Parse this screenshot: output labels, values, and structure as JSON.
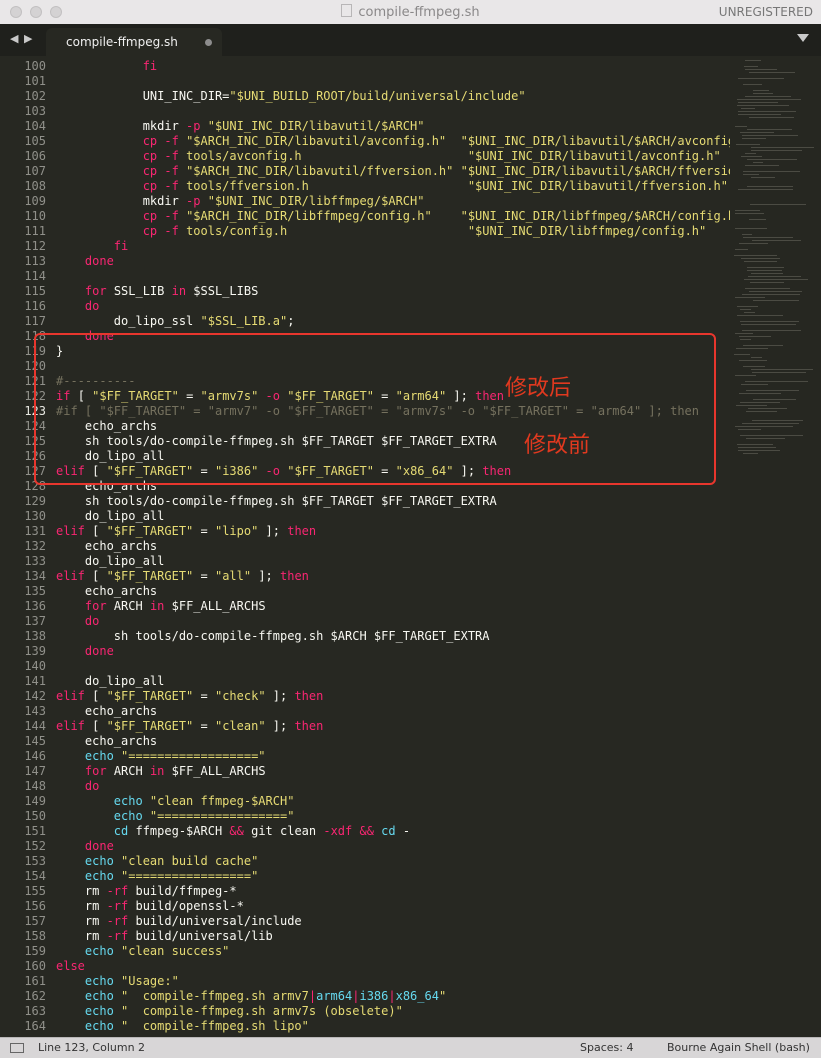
{
  "window": {
    "title": "compile-ffmpeg.sh",
    "registration": "UNREGISTERED"
  },
  "tab": {
    "label": "compile-ffmpeg.sh"
  },
  "status": {
    "position": "Line 123, Column 2",
    "spaces": "Spaces: 4",
    "syntax": "Bourne Again Shell (bash)"
  },
  "annotations": {
    "after": "修改后",
    "before": "修改前"
  },
  "colors": {
    "editor_bg": "#272822",
    "keyword": "#f92672",
    "string": "#e6db74",
    "annotation": "#e8362d"
  },
  "lines": [
    {
      "n": "100",
      "t": [
        [
          "            ",
          ""
        ],
        [
          "fi",
          "kw"
        ]
      ]
    },
    {
      "n": "101",
      "t": []
    },
    {
      "n": "102",
      "t": [
        [
          "            UNI_INC_DIR=",
          ""
        ],
        [
          "\"$UNI_BUILD_ROOT/build/universal/include\"",
          "str"
        ]
      ]
    },
    {
      "n": "103",
      "t": []
    },
    {
      "n": "104",
      "t": [
        [
          "            mkdir ",
          ""
        ],
        [
          "-p ",
          "kw"
        ],
        [
          "\"$UNI_INC_DIR/libavutil/$ARCH\"",
          "str"
        ]
      ]
    },
    {
      "n": "105",
      "t": [
        [
          "            cp ",
          "kw"
        ],
        [
          "-f ",
          "kw"
        ],
        [
          "\"$ARCH_INC_DIR/libavutil/avconfig.h\"  ",
          "str"
        ],
        [
          "\"$UNI_INC_DIR/libavutil/$ARCH/avconfig.h\"",
          "str"
        ]
      ]
    },
    {
      "n": "106",
      "t": [
        [
          "            cp ",
          "kw"
        ],
        [
          "-f ",
          "kw"
        ],
        [
          "tools/avconfig.h                       ",
          "str"
        ],
        [
          "\"$UNI_INC_DIR/libavutil/avconfig.h\"",
          "str"
        ]
      ]
    },
    {
      "n": "107",
      "t": [
        [
          "            cp ",
          "kw"
        ],
        [
          "-f ",
          "kw"
        ],
        [
          "\"$ARCH_INC_DIR/libavutil/ffversion.h\" ",
          "str"
        ],
        [
          "\"$UNI_INC_DIR/libavutil/$ARCH/ffversion.h\"",
          "str"
        ]
      ]
    },
    {
      "n": "108",
      "t": [
        [
          "            cp ",
          "kw"
        ],
        [
          "-f ",
          "kw"
        ],
        [
          "tools/ffversion.h                      ",
          "str"
        ],
        [
          "\"$UNI_INC_DIR/libavutil/ffversion.h\"",
          "str"
        ]
      ]
    },
    {
      "n": "109",
      "t": [
        [
          "            mkdir ",
          ""
        ],
        [
          "-p ",
          "kw"
        ],
        [
          "\"$UNI_INC_DIR/libffmpeg/$ARCH\"",
          "str"
        ]
      ]
    },
    {
      "n": "110",
      "t": [
        [
          "            cp ",
          "kw"
        ],
        [
          "-f ",
          "kw"
        ],
        [
          "\"$ARCH_INC_DIR/libffmpeg/config.h\"    ",
          "str"
        ],
        [
          "\"$UNI_INC_DIR/libffmpeg/$ARCH/config.h\"",
          "str"
        ]
      ]
    },
    {
      "n": "111",
      "t": [
        [
          "            cp ",
          "kw"
        ],
        [
          "-f ",
          "kw"
        ],
        [
          "tools/config.h                         ",
          "str"
        ],
        [
          "\"$UNI_INC_DIR/libffmpeg/config.h\"",
          "str"
        ]
      ]
    },
    {
      "n": "112",
      "t": [
        [
          "        ",
          ""
        ],
        [
          "fi",
          "kw"
        ]
      ]
    },
    {
      "n": "113",
      "t": [
        [
          "    ",
          ""
        ],
        [
          "done",
          "kw"
        ]
      ]
    },
    {
      "n": "114",
      "t": []
    },
    {
      "n": "115",
      "t": [
        [
          "    ",
          ""
        ],
        [
          "for ",
          "kw"
        ],
        [
          "SSL_LIB ",
          ""
        ],
        [
          "in ",
          "kw"
        ],
        [
          "$SSL_LIBS",
          ""
        ]
      ]
    },
    {
      "n": "116",
      "t": [
        [
          "    ",
          ""
        ],
        [
          "do",
          "kw"
        ]
      ]
    },
    {
      "n": "117",
      "t": [
        [
          "        do_lipo_ssl ",
          ""
        ],
        [
          "\"$SSL_LIB.a\"",
          "str"
        ],
        [
          ";",
          ""
        ]
      ]
    },
    {
      "n": "118",
      "t": [
        [
          "    ",
          ""
        ],
        [
          "done",
          "kw"
        ]
      ]
    },
    {
      "n": "119",
      "t": [
        [
          "}",
          ""
        ]
      ]
    },
    {
      "n": "120",
      "t": []
    },
    {
      "n": "121",
      "t": [
        [
          "#----------",
          "cmt"
        ]
      ]
    },
    {
      "n": "122",
      "t": [
        [
          "if ",
          "kw"
        ],
        [
          "[ ",
          ""
        ],
        [
          "\"$FF_TARGET\"",
          "str"
        ],
        [
          " = ",
          ""
        ],
        [
          "\"armv7s\"",
          "str"
        ],
        [
          " -o ",
          "kw"
        ],
        [
          "\"$FF_TARGET\"",
          "str"
        ],
        [
          " = ",
          ""
        ],
        [
          "\"arm64\"",
          "str"
        ],
        [
          " ]; ",
          ""
        ],
        [
          "then",
          "kw"
        ]
      ]
    },
    {
      "n": "123",
      "t": [
        [
          "#if [ \"$FF_TARGET\" = \"armv7\" -o \"$FF_TARGET\" = \"armv7s\" -o \"$FF_TARGET\" = \"arm64\" ]; then",
          "cmt"
        ]
      ]
    },
    {
      "n": "124",
      "t": [
        [
          "    echo_archs",
          ""
        ]
      ]
    },
    {
      "n": "125",
      "t": [
        [
          "    sh tools/do-compile-ffmpeg.sh ",
          ""
        ],
        [
          "$FF_TARGET $FF_TARGET_EXTRA",
          ""
        ]
      ]
    },
    {
      "n": "126",
      "t": [
        [
          "    do_lipo_all",
          ""
        ]
      ]
    },
    {
      "n": "127",
      "t": [
        [
          "elif ",
          "kw"
        ],
        [
          "[ ",
          ""
        ],
        [
          "\"$FF_TARGET\"",
          "str"
        ],
        [
          " = ",
          ""
        ],
        [
          "\"i386\"",
          "str"
        ],
        [
          " -o ",
          "kw"
        ],
        [
          "\"$FF_TARGET\"",
          "str"
        ],
        [
          " = ",
          ""
        ],
        [
          "\"x86_64\"",
          "str"
        ],
        [
          " ]; ",
          ""
        ],
        [
          "then",
          "kw"
        ]
      ]
    },
    {
      "n": "128",
      "t": [
        [
          "    echo_archs",
          ""
        ]
      ]
    },
    {
      "n": "129",
      "t": [
        [
          "    sh tools/do-compile-ffmpeg.sh ",
          ""
        ],
        [
          "$FF_TARGET $FF_TARGET_EXTRA",
          ""
        ]
      ]
    },
    {
      "n": "130",
      "t": [
        [
          "    do_lipo_all",
          ""
        ]
      ]
    },
    {
      "n": "131",
      "t": [
        [
          "elif ",
          "kw"
        ],
        [
          "[ ",
          ""
        ],
        [
          "\"$FF_TARGET\"",
          "str"
        ],
        [
          " = ",
          ""
        ],
        [
          "\"lipo\"",
          "str"
        ],
        [
          " ]; ",
          ""
        ],
        [
          "then",
          "kw"
        ]
      ]
    },
    {
      "n": "132",
      "t": [
        [
          "    echo_archs",
          ""
        ]
      ]
    },
    {
      "n": "133",
      "t": [
        [
          "    do_lipo_all",
          ""
        ]
      ]
    },
    {
      "n": "134",
      "t": [
        [
          "elif ",
          "kw"
        ],
        [
          "[ ",
          ""
        ],
        [
          "\"$FF_TARGET\"",
          "str"
        ],
        [
          " = ",
          ""
        ],
        [
          "\"all\"",
          "str"
        ],
        [
          " ]; ",
          ""
        ],
        [
          "then",
          "kw"
        ]
      ]
    },
    {
      "n": "135",
      "t": [
        [
          "    echo_archs",
          ""
        ]
      ]
    },
    {
      "n": "136",
      "t": [
        [
          "    ",
          ""
        ],
        [
          "for ",
          "kw"
        ],
        [
          "ARCH ",
          ""
        ],
        [
          "in ",
          "kw"
        ],
        [
          "$FF_ALL_ARCHS",
          ""
        ]
      ]
    },
    {
      "n": "137",
      "t": [
        [
          "    ",
          ""
        ],
        [
          "do",
          "kw"
        ]
      ]
    },
    {
      "n": "138",
      "t": [
        [
          "        sh tools/do-compile-ffmpeg.sh ",
          ""
        ],
        [
          "$ARCH $FF_TARGET_EXTRA",
          ""
        ]
      ]
    },
    {
      "n": "139",
      "t": [
        [
          "    ",
          ""
        ],
        [
          "done",
          "kw"
        ]
      ]
    },
    {
      "n": "140",
      "t": []
    },
    {
      "n": "141",
      "t": [
        [
          "    do_lipo_all",
          ""
        ]
      ]
    },
    {
      "n": "142",
      "t": [
        [
          "elif ",
          "kw"
        ],
        [
          "[ ",
          ""
        ],
        [
          "\"$FF_TARGET\"",
          "str"
        ],
        [
          " = ",
          ""
        ],
        [
          "\"check\"",
          "str"
        ],
        [
          " ]; ",
          ""
        ],
        [
          "then",
          "kw"
        ]
      ]
    },
    {
      "n": "143",
      "t": [
        [
          "    echo_archs",
          ""
        ]
      ]
    },
    {
      "n": "144",
      "t": [
        [
          "elif ",
          "kw"
        ],
        [
          "[ ",
          ""
        ],
        [
          "\"$FF_TARGET\"",
          "str"
        ],
        [
          " = ",
          ""
        ],
        [
          "\"clean\"",
          "str"
        ],
        [
          " ]; ",
          ""
        ],
        [
          "then",
          "kw"
        ]
      ]
    },
    {
      "n": "145",
      "t": [
        [
          "    echo_archs",
          ""
        ]
      ]
    },
    {
      "n": "146",
      "t": [
        [
          "    ",
          ""
        ],
        [
          "echo ",
          "cyan"
        ],
        [
          "\"==================\"",
          "str"
        ]
      ]
    },
    {
      "n": "147",
      "t": [
        [
          "    ",
          ""
        ],
        [
          "for ",
          "kw"
        ],
        [
          "ARCH ",
          ""
        ],
        [
          "in ",
          "kw"
        ],
        [
          "$FF_ALL_ARCHS",
          ""
        ]
      ]
    },
    {
      "n": "148",
      "t": [
        [
          "    ",
          ""
        ],
        [
          "do",
          "kw"
        ]
      ]
    },
    {
      "n": "149",
      "t": [
        [
          "        ",
          ""
        ],
        [
          "echo ",
          "cyan"
        ],
        [
          "\"clean ffmpeg-$ARCH\"",
          "str"
        ]
      ]
    },
    {
      "n": "150",
      "t": [
        [
          "        ",
          ""
        ],
        [
          "echo ",
          "cyan"
        ],
        [
          "\"==================\"",
          "str"
        ]
      ]
    },
    {
      "n": "151",
      "t": [
        [
          "        ",
          ""
        ],
        [
          "cd ",
          "cyan"
        ],
        [
          "ffmpeg-$ARCH ",
          ""
        ],
        [
          "&& ",
          "kw"
        ],
        [
          "git clean ",
          ""
        ],
        [
          "-xdf ",
          "kw"
        ],
        [
          "&& ",
          "kw"
        ],
        [
          "cd ",
          "cyan"
        ],
        [
          "-",
          ""
        ]
      ]
    },
    {
      "n": "152",
      "t": [
        [
          "    ",
          ""
        ],
        [
          "done",
          "kw"
        ]
      ]
    },
    {
      "n": "153",
      "t": [
        [
          "    ",
          ""
        ],
        [
          "echo ",
          "cyan"
        ],
        [
          "\"clean build cache\"",
          "str"
        ]
      ]
    },
    {
      "n": "154",
      "t": [
        [
          "    ",
          ""
        ],
        [
          "echo ",
          "cyan"
        ],
        [
          "\"=================\"",
          "str"
        ]
      ]
    },
    {
      "n": "155",
      "t": [
        [
          "    rm ",
          ""
        ],
        [
          "-rf ",
          "kw"
        ],
        [
          "build/ffmpeg-*",
          ""
        ]
      ]
    },
    {
      "n": "156",
      "t": [
        [
          "    rm ",
          ""
        ],
        [
          "-rf ",
          "kw"
        ],
        [
          "build/openssl-*",
          ""
        ]
      ]
    },
    {
      "n": "157",
      "t": [
        [
          "    rm ",
          ""
        ],
        [
          "-rf ",
          "kw"
        ],
        [
          "build/universal/include",
          ""
        ]
      ]
    },
    {
      "n": "158",
      "t": [
        [
          "    rm ",
          ""
        ],
        [
          "-rf ",
          "kw"
        ],
        [
          "build/universal/lib",
          ""
        ]
      ]
    },
    {
      "n": "159",
      "t": [
        [
          "    ",
          ""
        ],
        [
          "echo ",
          "cyan"
        ],
        [
          "\"clean success\"",
          "str"
        ]
      ]
    },
    {
      "n": "160",
      "t": [
        [
          "else",
          "kw"
        ]
      ]
    },
    {
      "n": "161",
      "t": [
        [
          "    ",
          ""
        ],
        [
          "echo ",
          "cyan"
        ],
        [
          "\"Usage:\"",
          "str"
        ]
      ]
    },
    {
      "n": "162",
      "t": [
        [
          "    ",
          ""
        ],
        [
          "echo ",
          "cyan"
        ],
        [
          "\"  compile-ffmpeg.sh armv7",
          "str"
        ],
        [
          "|",
          "kw"
        ],
        [
          "arm64",
          "cyan"
        ],
        [
          "|",
          "kw"
        ],
        [
          "i386",
          "cyan"
        ],
        [
          "|",
          "kw"
        ],
        [
          "x86_64",
          "cyan"
        ],
        [
          "\"",
          "str"
        ]
      ]
    },
    {
      "n": "163",
      "t": [
        [
          "    ",
          ""
        ],
        [
          "echo ",
          "cyan"
        ],
        [
          "\"  compile-ffmpeg.sh armv7s (obselete)\"",
          "str"
        ]
      ]
    },
    {
      "n": "164",
      "t": [
        [
          "    ",
          ""
        ],
        [
          "echo ",
          "cyan"
        ],
        [
          "\"  compile-ffmpeg.sh lipo\"",
          "str"
        ]
      ]
    }
  ]
}
